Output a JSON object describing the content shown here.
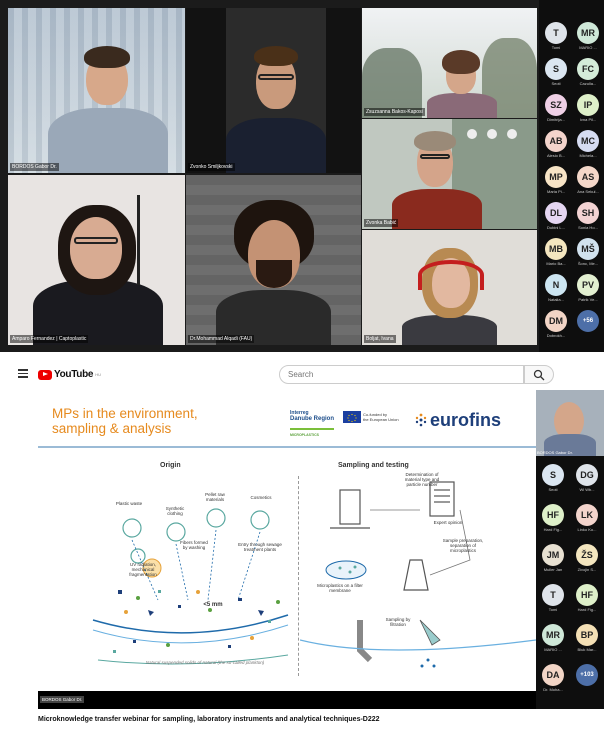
{
  "meeting": {
    "tiles": [
      {
        "name": "BORDOS Gabor Dr."
      },
      {
        "name": "Zvonko Smiljkovski"
      },
      {
        "name": "Zsuzsanna Bakos-Kaposi"
      },
      {
        "name": "Amparo Fernandez | Captoplastic"
      },
      {
        "name": "Dr.Mohammad Alqadi (FAU)"
      },
      {
        "name": "Zvonka Babić"
      },
      {
        "name": "Boljat, Ivana"
      }
    ],
    "participants": [
      {
        "initials": "T",
        "name": "Tomi",
        "color": "#dfe4ea"
      },
      {
        "initials": "MR",
        "name": "MARIO ...",
        "color": "#cfe8d8"
      },
      {
        "initials": "S",
        "name": "Seoti",
        "color": "#dbe6f1"
      },
      {
        "initials": "FC",
        "name": "Cazulla...",
        "color": "#d4ecd9"
      },
      {
        "initials": "SZ",
        "name": "Dimitrija...",
        "color": "#efd0e6"
      },
      {
        "initials": "IP",
        "name": "Ivna Pil...",
        "color": "#def0c9"
      },
      {
        "initials": "AB",
        "name": "Alesio B...",
        "color": "#f3d4cc"
      },
      {
        "initials": "MC",
        "name": "Michela...",
        "color": "#d6dcf2"
      },
      {
        "initials": "MP",
        "name": "Maria Pi...",
        "color": "#f7e4c6"
      },
      {
        "initials": "AS",
        "name": "Ana Sekul...",
        "color": "#f4d7c9"
      },
      {
        "initials": "DL",
        "name": "Dubini L...",
        "color": "#e5d6f2"
      },
      {
        "initials": "SH",
        "name": "Sonia Ho...",
        "color": "#f3d3d3"
      },
      {
        "initials": "MB",
        "name": "Mario Ba...",
        "color": "#f4e6bf"
      },
      {
        "initials": "MŠ",
        "name": "Šonc, Me...",
        "color": "#d1e2ee"
      },
      {
        "initials": "N",
        "name": "Natalia...",
        "color": "#cde6f2"
      },
      {
        "initials": "PV",
        "name": "Patrik Ve...",
        "color": "#e3f0d1"
      },
      {
        "initials": "DM",
        "name": "Dobrokh...",
        "color": "#f2d5c6"
      },
      {
        "initials": "+56",
        "name": "",
        "color": "#4d6fa8"
      }
    ]
  },
  "youtube": {
    "brand": "YouTube",
    "region": "HU",
    "search_placeholder": "Search",
    "caption": "Microknowledge transfer webinar for sampling, laboratory instruments and analytical techniques-D222",
    "presenter_label": "BORDOS Gabor Dr.",
    "bottom_label": "BORDOS Gabor Dr.",
    "side_participants": [
      {
        "initials": "S",
        "name": "Seoti",
        "color": "#dbe6f1"
      },
      {
        "initials": "DG",
        "name": "Wi Wb...",
        "color": "#dfe4ea"
      },
      {
        "initials": "HF",
        "name": "Hard Fig...",
        "color": "#def0c9"
      },
      {
        "initials": "LK",
        "name": "Linko Ko...",
        "color": "#f3d4cc"
      },
      {
        "initials": "JM",
        "name": "Muller Jan",
        "color": "#e8e1d2"
      },
      {
        "initials": "ŽS",
        "name": "Zivojin S...",
        "color": "#f4e6bf"
      },
      {
        "initials": "T",
        "name": "Tomi",
        "color": "#dfe4ea"
      },
      {
        "initials": "HF",
        "name": "Hard Fig...",
        "color": "#def0c9"
      },
      {
        "initials": "MR",
        "name": "MARIO ...",
        "color": "#cfe8d8"
      },
      {
        "initials": "BP",
        "name": "Bluk Mar...",
        "color": "#f4e0b5"
      },
      {
        "initials": "DA",
        "name": "Dr. Moha...",
        "color": "#f2d5c6"
      },
      {
        "initials": "+103",
        "name": "",
        "color": "#4d6fa8"
      }
    ]
  },
  "slide": {
    "title_line1": "MPs in the environment,",
    "title_line2": "sampling & analysis",
    "brand": "eurofins",
    "programme_l1": "Interreg",
    "programme_l2": "Danube Region",
    "programme_l3": "MICROPLASTICS",
    "eu_l1": "Co-funded by",
    "eu_l2": "the European Union",
    "section_origin": "Origin",
    "section_sampling": "Sampling and testing",
    "labels": {
      "plastic_waste": "Plastic waste",
      "synthetic_clothing": "Synthetic clothing",
      "pellet": "Pellet raw materials",
      "cosmetics": "Cosmetics",
      "fibers": "Fibers formed by washing",
      "sewage": "Entry through sewage treatment plants",
      "uv": "UV radiation, mechanical fragmentation",
      "size": "<5 mm",
      "determination": "Determination of material type and particle number",
      "expert": "Expert opinion",
      "sample_prep": "Sample preparation, separation of microplastics",
      "filter_membrane": "Microplastics on a filter membrane",
      "filtration": "Sampling by filtration",
      "water_note": "Natural suspended solids of natural (the so-called plankton)"
    }
  }
}
